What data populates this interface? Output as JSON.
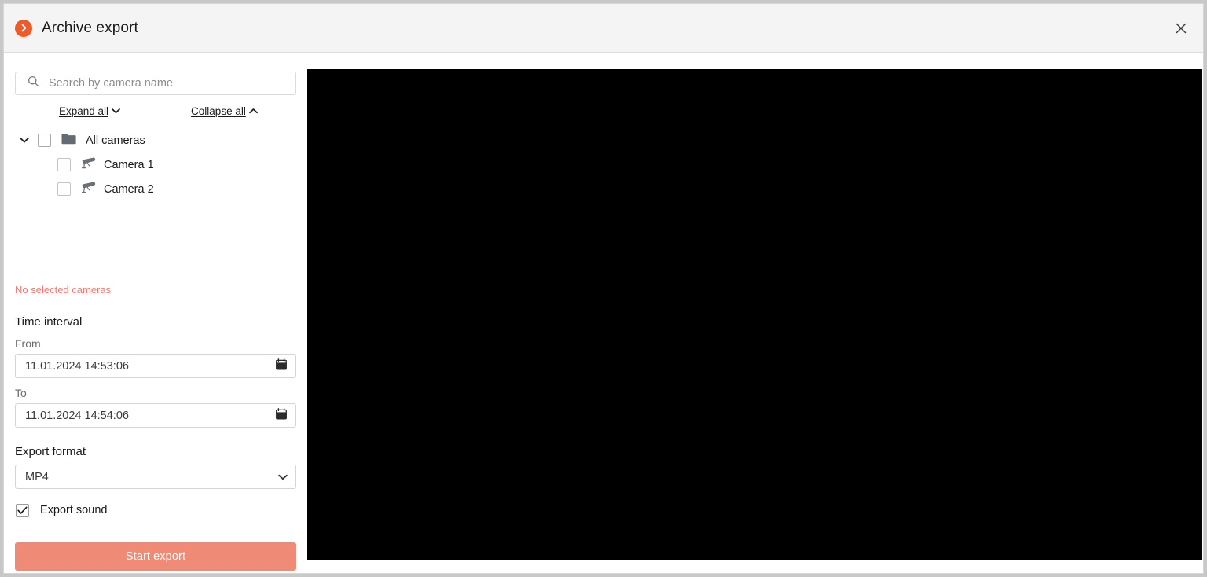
{
  "window": {
    "title": "Archive export",
    "app_icon": "chevron-right-circle-icon",
    "close_icon": "close-icon",
    "accent_color": "#ef5a28"
  },
  "panel": {
    "search": {
      "placeholder": "Search by camera name",
      "value": "",
      "icon": "search-icon"
    },
    "tree_actions": {
      "expand_all": "Expand all",
      "collapse_all": "Collapse all"
    },
    "tree": {
      "root": {
        "label": "All cameras",
        "icon": "folder-icon",
        "expanded": true,
        "checked": false
      },
      "children": [
        {
          "label": "Camera 1",
          "icon": "cctv-camera-icon",
          "checked": false
        },
        {
          "label": "Camera 2",
          "icon": "cctv-camera-icon",
          "checked": false
        }
      ]
    },
    "warning": {
      "text": "No selected cameras",
      "color": "#f4776e"
    },
    "time_interval": {
      "section_label": "Time interval",
      "from_label": "From",
      "from_value": "11.01.2024 14:53:06",
      "to_label": "To",
      "to_value": "11.01.2024 14:54:06",
      "calendar_icon": "calendar-icon"
    },
    "export_format": {
      "label": "Export format",
      "selected": "MP4",
      "options": [
        "MP4"
      ],
      "arrow_icon": "chevron-down-icon"
    },
    "export_sound": {
      "label": "Export sound",
      "checked": true
    },
    "start_button": {
      "label": "Start export",
      "color": "#ef8a76",
      "enabled": false
    }
  },
  "preview": {
    "name": "video-preview",
    "background": "#000000"
  }
}
